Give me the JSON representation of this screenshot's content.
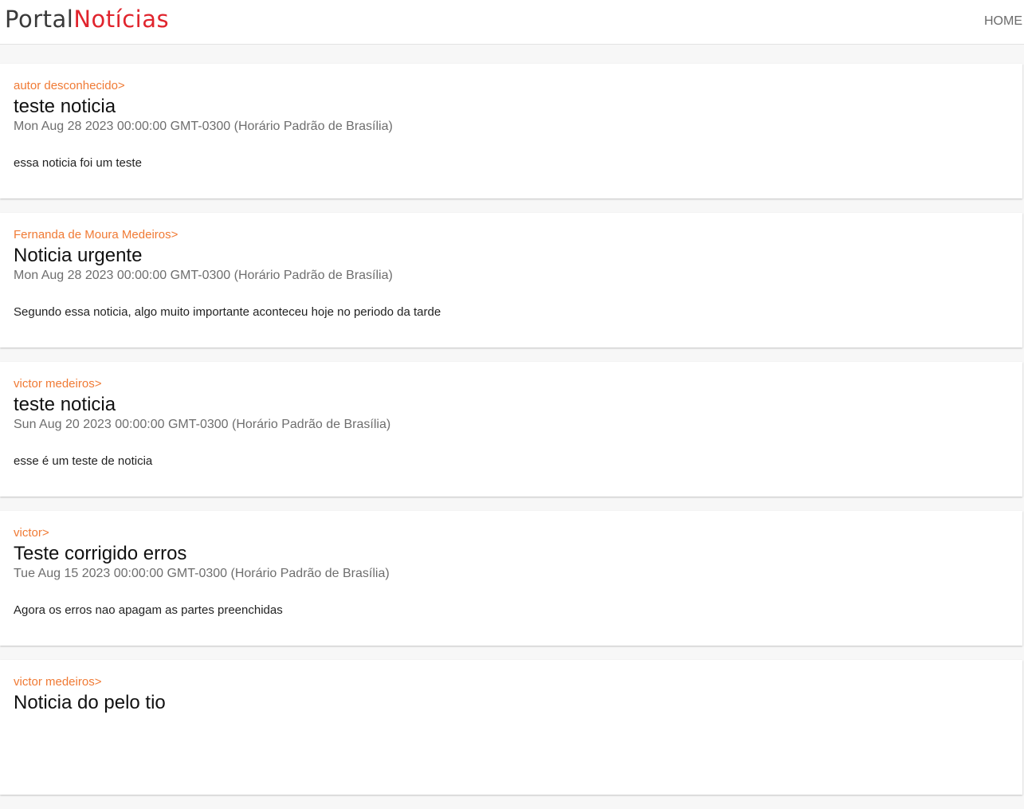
{
  "navbar": {
    "brand_part1": "Portal",
    "brand_part2": "Notícias",
    "home_label": "HOME"
  },
  "colors": {
    "brand_dark": "#3a3a3a",
    "brand_red": "#e0242d",
    "author_orange": "#f07a34",
    "page_background": "#f7f7f7"
  },
  "news": [
    {
      "author": "autor desconhecido>",
      "title": "teste noticia",
      "date": "Mon Aug 28 2023 00:00:00 GMT-0300 (Horário Padrão de Brasília)",
      "body": "essa noticia foi um teste"
    },
    {
      "author": "Fernanda de Moura Medeiros>",
      "title": "Noticia urgente",
      "date": "Mon Aug 28 2023 00:00:00 GMT-0300 (Horário Padrão de Brasília)",
      "body": "Segundo essa noticia, algo muito importante aconteceu hoje no periodo da tarde"
    },
    {
      "author": "victor medeiros>",
      "title": "teste noticia",
      "date": "Sun Aug 20 2023 00:00:00 GMT-0300 (Horário Padrão de Brasília)",
      "body": "esse é um teste de noticia"
    },
    {
      "author": "victor>",
      "title": "Teste corrigido erros",
      "date": "Tue Aug 15 2023 00:00:00 GMT-0300 (Horário Padrão de Brasília)",
      "body": "Agora os erros nao apagam as partes preenchidas"
    },
    {
      "author": "victor medeiros>",
      "title": "Noticia do pelo tio",
      "date": "",
      "body": ""
    }
  ]
}
